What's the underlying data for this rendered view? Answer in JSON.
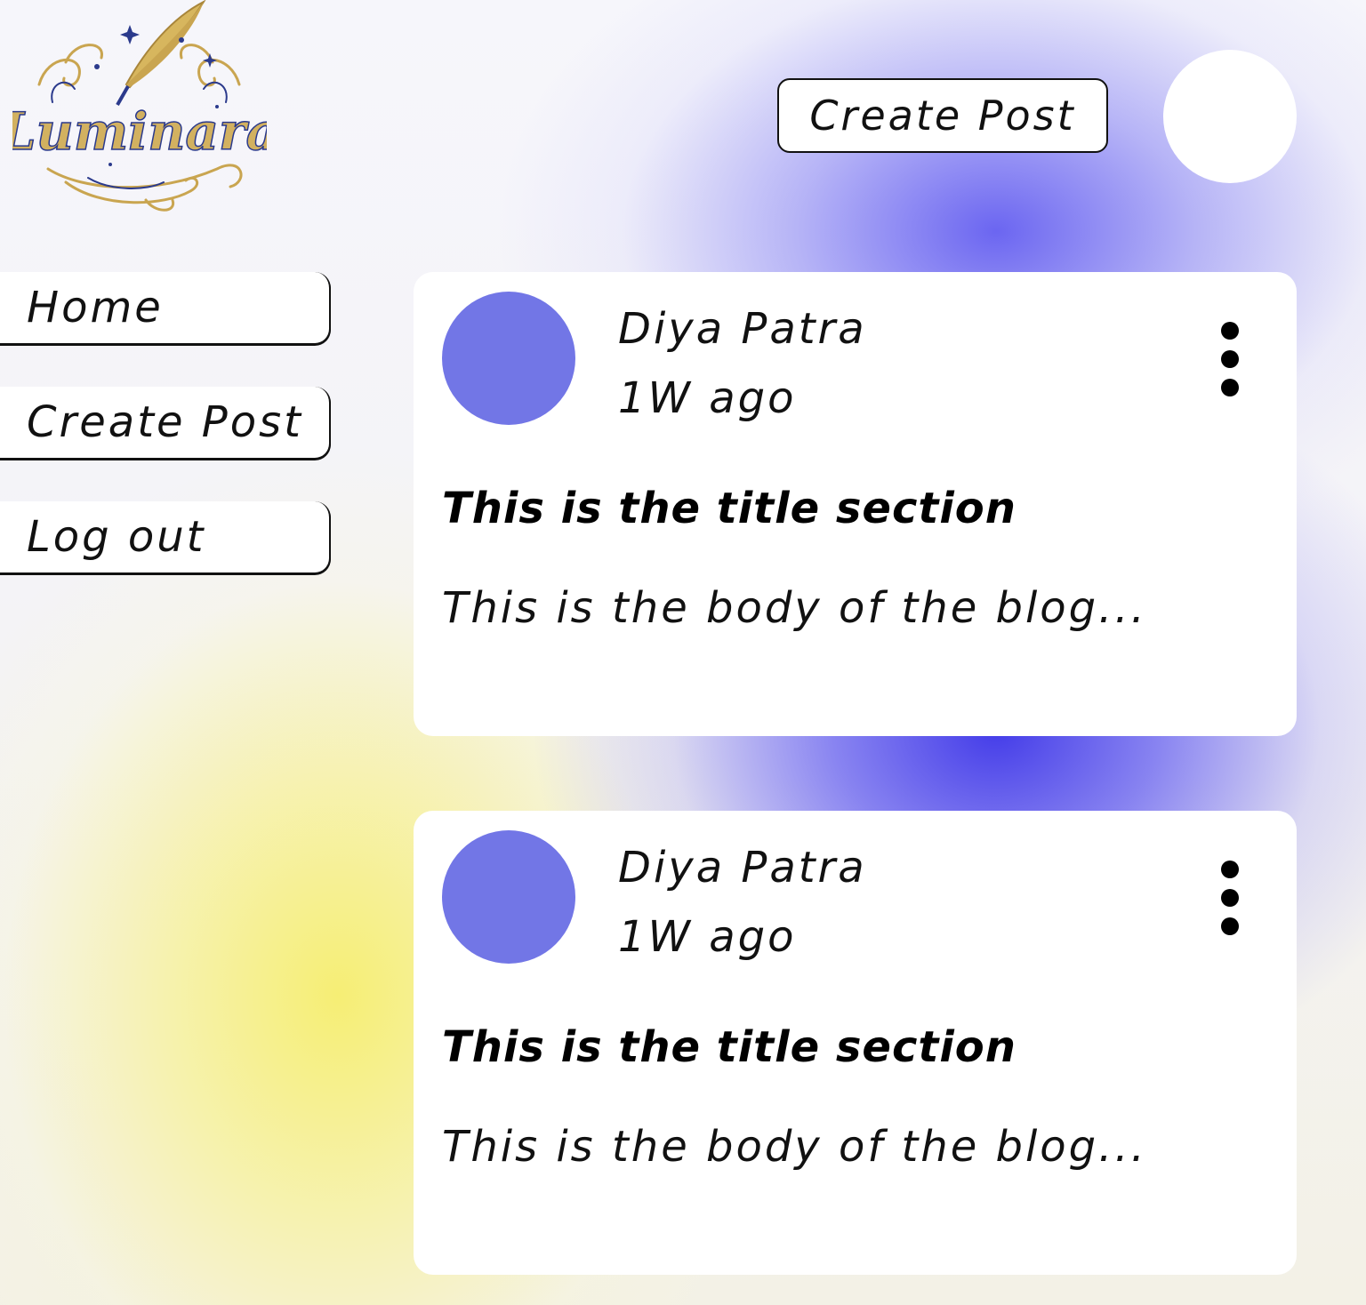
{
  "logo": {
    "text": "Luminara",
    "icon": "quill-pen-icon",
    "colors": {
      "gold": "#c9a550",
      "navy": "#2b3a8c"
    }
  },
  "header": {
    "create_post_label": "Create Post",
    "avatar_icon": "user-avatar-icon"
  },
  "sidebar": {
    "items": [
      {
        "label": "Home"
      },
      {
        "label": "Create Post"
      },
      {
        "label": "Log out"
      }
    ]
  },
  "posts": [
    {
      "author": "Diya Patra",
      "time": "1W ago",
      "title": "This is the title section",
      "body": "This is the body of the blog...",
      "menu_icon": "more-vertical-icon"
    },
    {
      "author": "Diya Patra",
      "time": "1W ago",
      "title": "This is the title section",
      "body": "This is the body of the blog...",
      "menu_icon": "more-vertical-icon"
    }
  ],
  "colors": {
    "avatar": "#7276e6",
    "accent_blue": "#3a32e8",
    "accent_yellow": "#f6ee6e",
    "card": "#ffffff",
    "text": "#111111"
  }
}
